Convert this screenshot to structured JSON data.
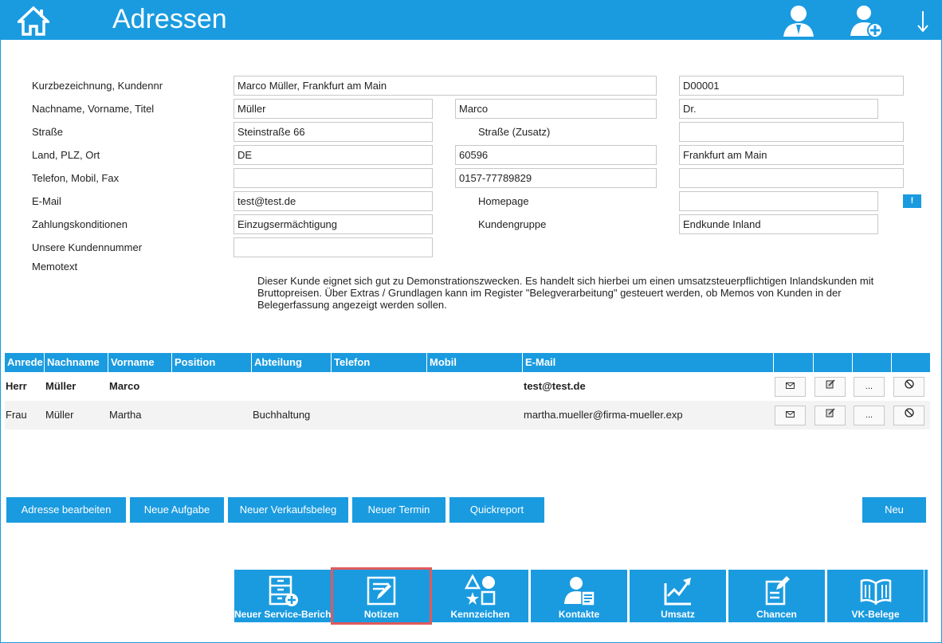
{
  "header": {
    "title": "Adressen",
    "icons": [
      "home-icon",
      "user-icon",
      "add-user-icon",
      "arrow-down-icon"
    ],
    "accent": "#1a9be0"
  },
  "form": {
    "labels": {
      "kurzbezeichnung": "Kurzbezeichnung, Kundennr",
      "name": "Nachname, Vorname, Titel",
      "strasse": "Straße",
      "strasse_zusatz": "Straße (Zusatz)",
      "land": "Land, PLZ, Ort",
      "telefon": "Telefon, Mobil, Fax",
      "email": "E-Mail",
      "homepage": "Homepage",
      "zahlung": "Zahlungskonditionen",
      "kundengruppe": "Kundengruppe",
      "unsere_kundennummer": "Unsere Kundennummer",
      "memotext": "Memotext"
    },
    "values": {
      "kurzbezeichnung": "Marco Müller, Frankfurt am Main",
      "kundennr": "D00001",
      "nachname": "Müller",
      "vorname": "Marco",
      "titel": "Dr.",
      "strasse": "Steinstraße 66",
      "strasse_zusatz": "",
      "land": "DE",
      "plz": "60596",
      "ort": "Frankfurt am Main",
      "telefon": "",
      "mobil": "0157-77789829",
      "fax": "",
      "email": "test@test.de",
      "homepage": "",
      "zahlung": "Einzugsermächtigung",
      "kundengruppe": "Endkunde Inland",
      "unsere_kundennummer": ""
    },
    "info_button": "!",
    "memo": "Dieser Kunde eignet sich gut zu Demonstrationszwecken. Es handelt sich hierbei um einen umsatzsteuerpflichtigen Inlandskunden mit Bruttopreisen. Über Extras / Grundlagen kann im Register \"Belegverarbeitung\" gesteuert werden, ob Memos von Kunden in der Belegerfassung angezeigt werden sollen."
  },
  "contacts": {
    "columns": [
      "Anrede",
      "Nachname",
      "Vorname",
      "Position",
      "Abteilung",
      "Telefon",
      "Mobil",
      "E-Mail"
    ],
    "rows": [
      {
        "anrede": "Herr",
        "nachname": "Müller",
        "vorname": "Marco",
        "position": "",
        "abteilung": "",
        "telefon": "",
        "mobil": "",
        "email": "test@test.de"
      },
      {
        "anrede": "Frau",
        "nachname": "Müller",
        "vorname": "Martha",
        "position": "",
        "abteilung": "Buchhaltung",
        "telefon": "",
        "mobil": "",
        "email": "martha.mueller@firma-mueller.exp"
      }
    ],
    "row_actions": {
      "more": "..."
    }
  },
  "actions": {
    "adresse_bearbeiten": "Adresse bearbeiten",
    "neue_aufgabe": "Neue Aufgabe",
    "neuer_verkaufsbeleg": "Neuer Verkaufsbeleg",
    "neuer_termin": "Neuer Termin",
    "quickreport": "Quickreport",
    "neu": "Neu"
  },
  "tiles": {
    "service": "Neuer Service-Bericht",
    "notizen": "Notizen",
    "kennzeichen": "Kennzeichen",
    "kontakte": "Kontakte",
    "umsatz": "Umsatz",
    "chancen": "Chancen",
    "vk_belege": "VK-Belege",
    "selected": "Notizen"
  }
}
